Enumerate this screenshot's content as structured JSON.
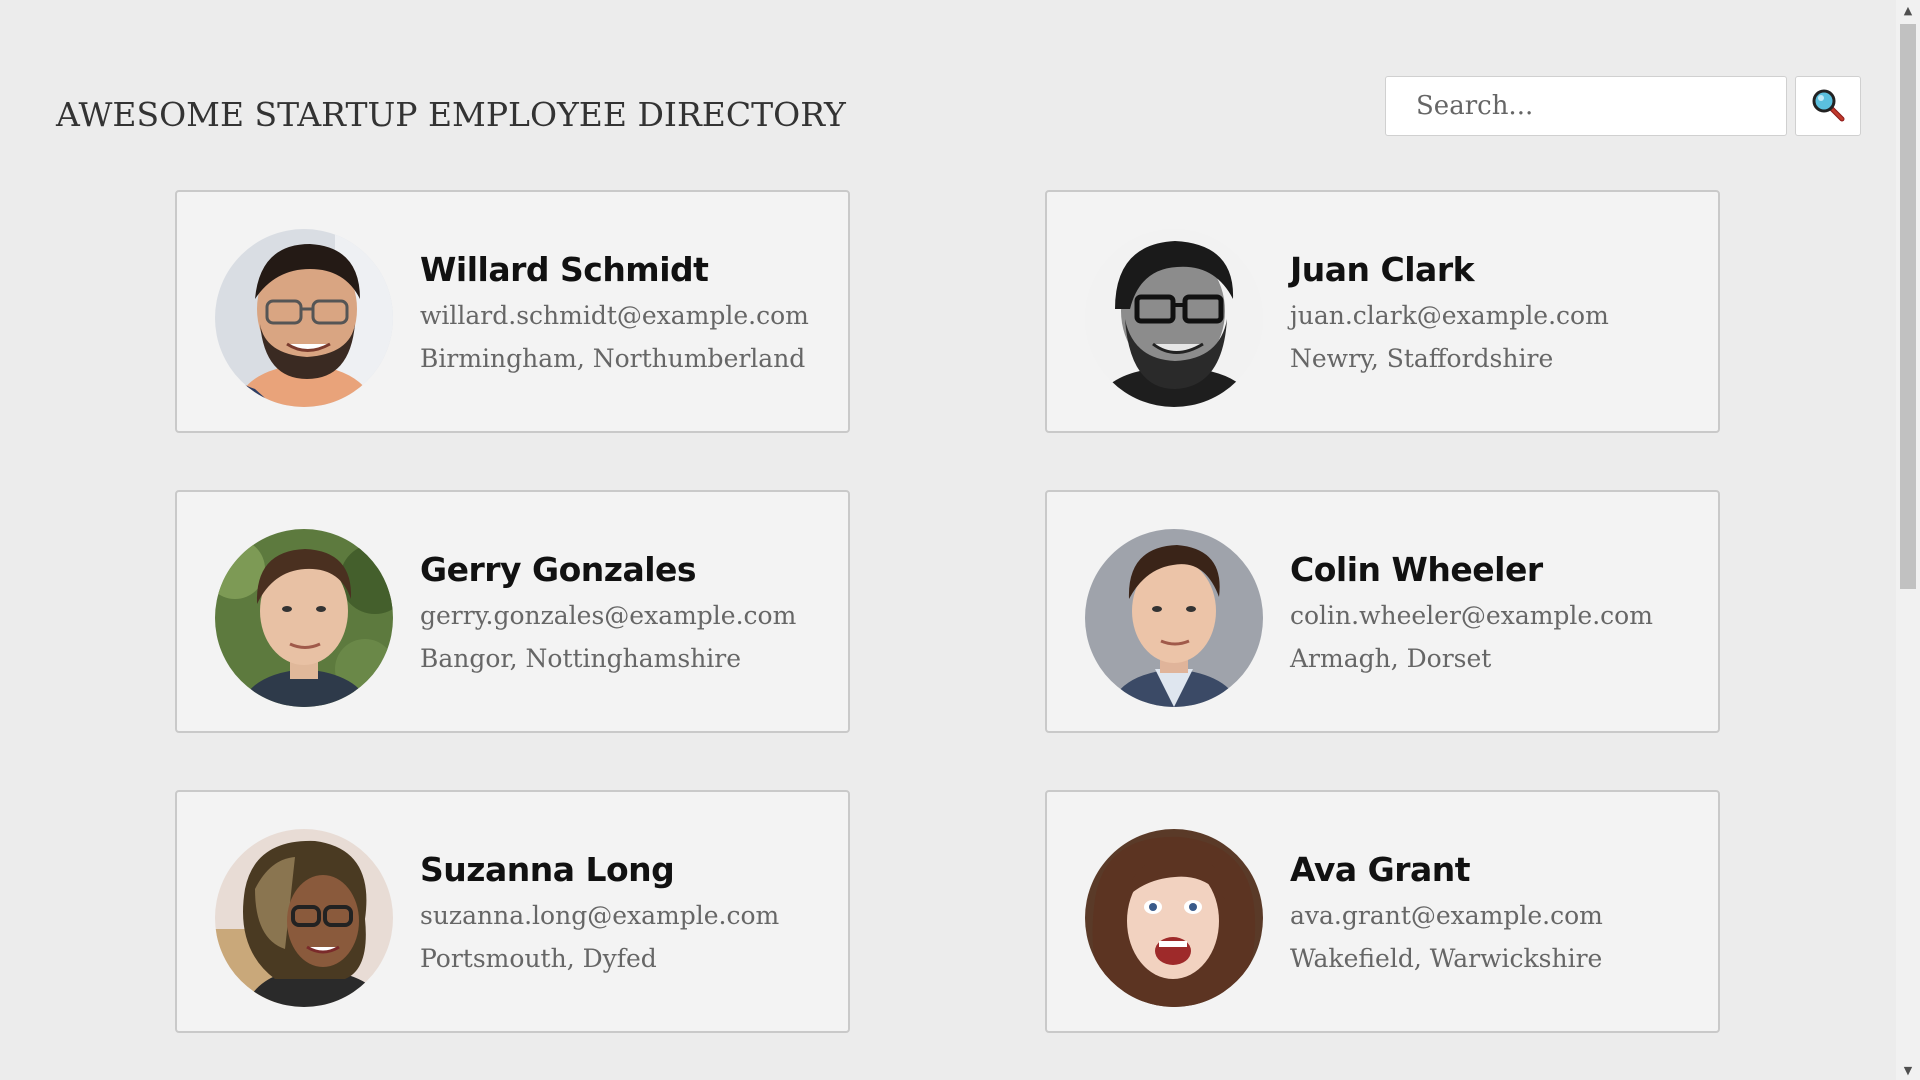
{
  "header": {
    "title": "AWESOME STARTUP EMPLOYEE DIRECTORY"
  },
  "search": {
    "placeholder": "Search...",
    "value": "",
    "button_icon": "magnifying-glass-icon"
  },
  "employees": [
    {
      "name": "Willard Schmidt",
      "email": "willard.schmidt@example.com",
      "location": "Birmingham, Northumberland"
    },
    {
      "name": "Juan Clark",
      "email": "juan.clark@example.com",
      "location": "Newry, Staffordshire"
    },
    {
      "name": "Gerry Gonzales",
      "email": "gerry.gonzales@example.com",
      "location": "Bangor, Nottinghamshire"
    },
    {
      "name": "Colin Wheeler",
      "email": "colin.wheeler@example.com",
      "location": "Armagh, Dorset"
    },
    {
      "name": "Suzanna Long",
      "email": "suzanna.long@example.com",
      "location": "Portsmouth, Dyfed"
    },
    {
      "name": "Ava Grant",
      "email": "ava.grant@example.com",
      "location": "Wakefield, Warwickshire"
    }
  ],
  "colors": {
    "background": "#ececec",
    "card_background": "#f3f3f3",
    "card_border": "#c9c9c9",
    "name_text": "#111111",
    "detail_text": "#666666"
  }
}
